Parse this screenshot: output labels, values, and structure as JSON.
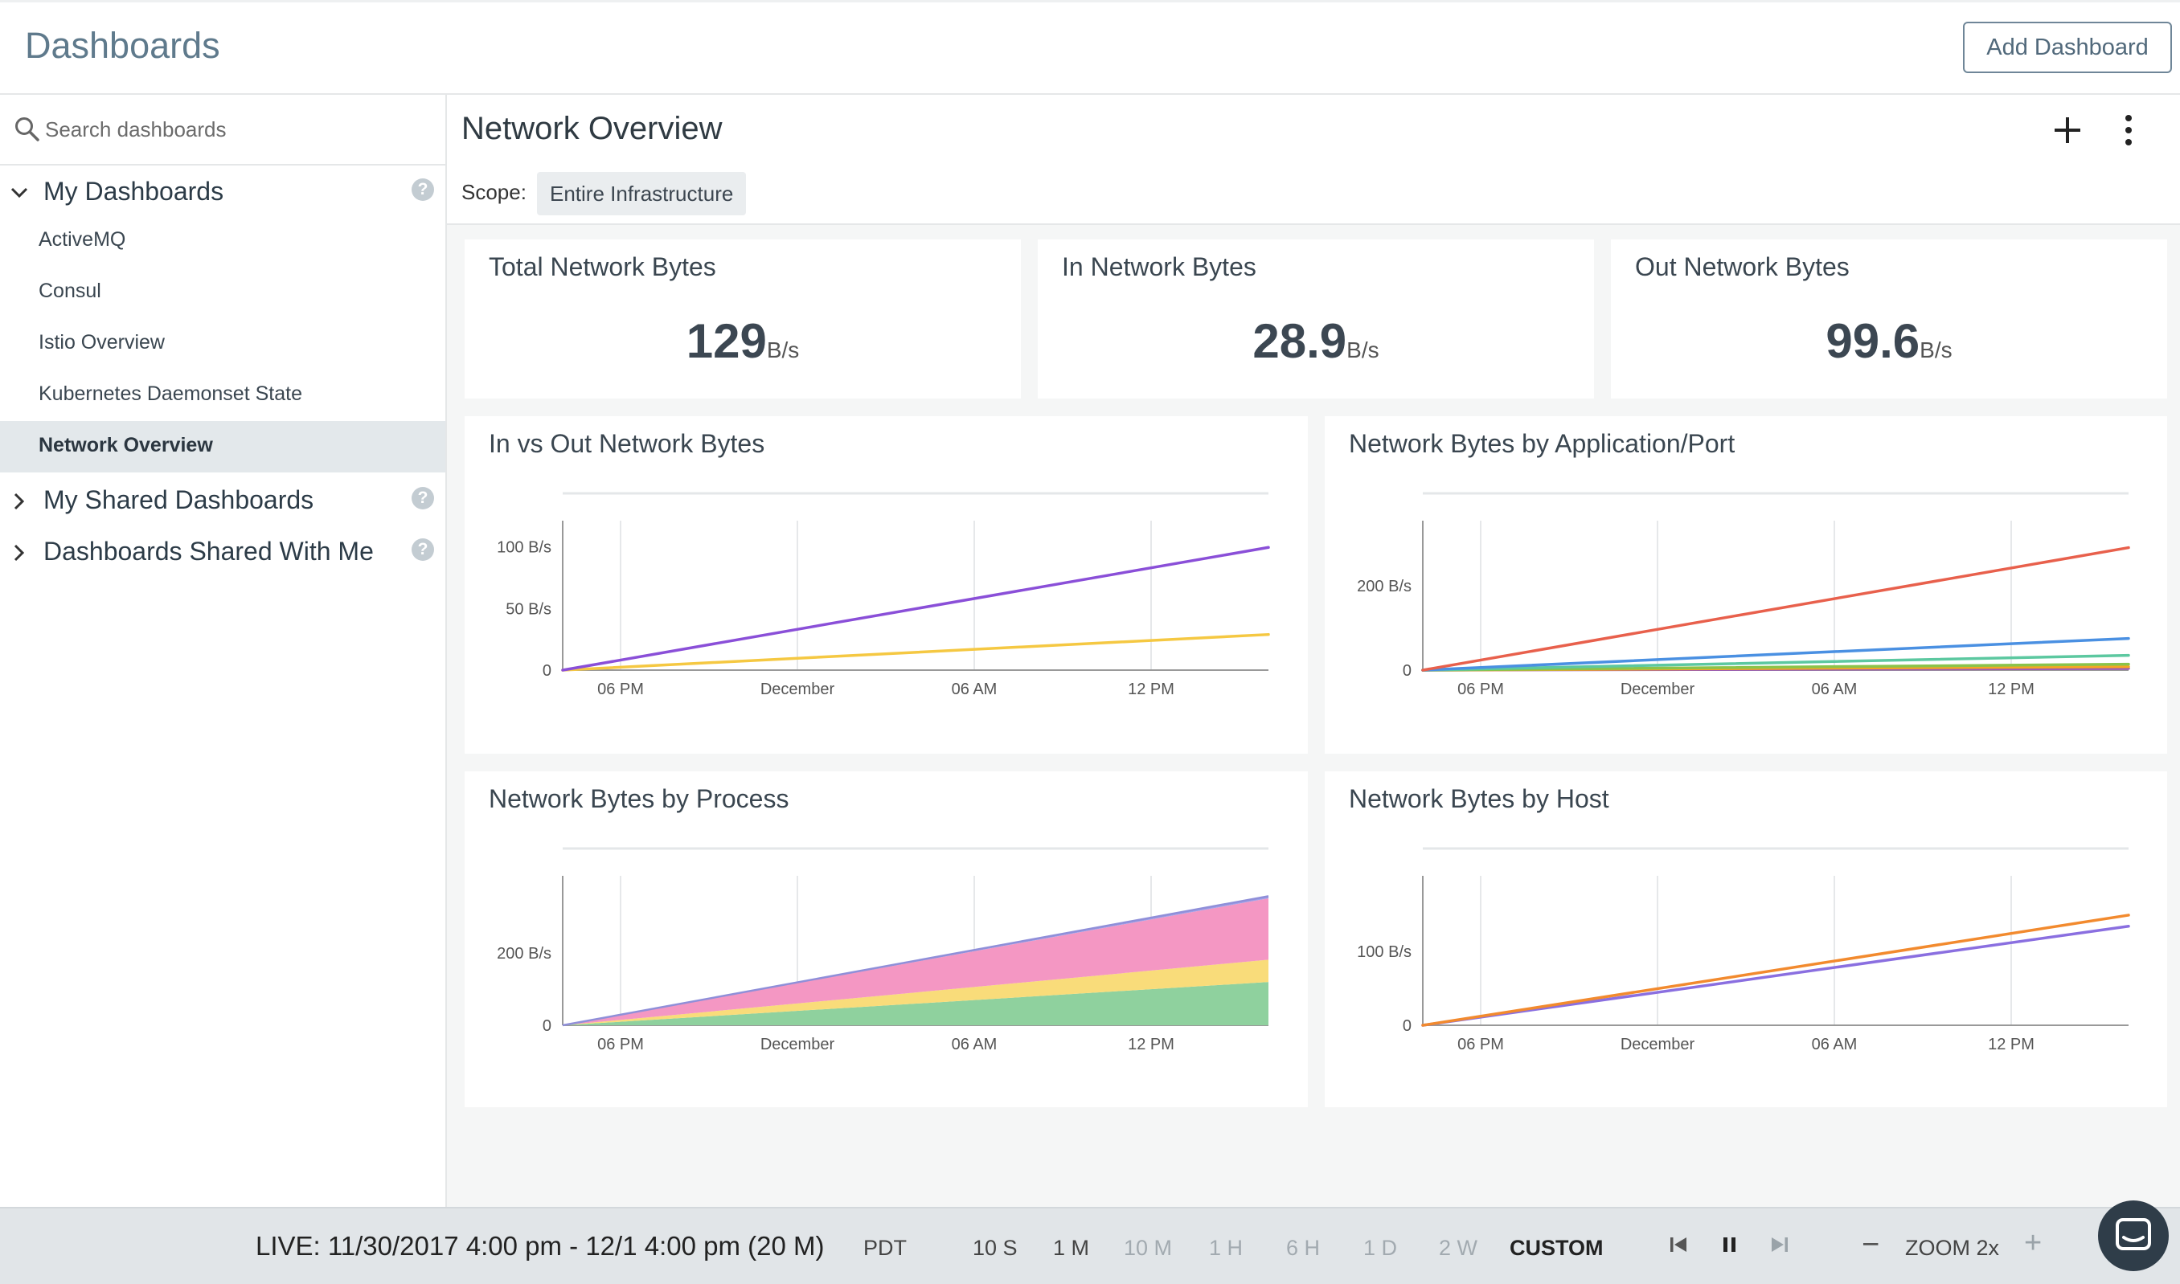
{
  "header": {
    "title": "Dashboards",
    "add_button": "Add Dashboard"
  },
  "sidebar": {
    "search_placeholder": "Search dashboards",
    "groups": [
      {
        "label": "My Dashboards",
        "expanded": true
      },
      {
        "label": "My Shared Dashboards",
        "expanded": false
      },
      {
        "label": "Dashboards Shared With Me",
        "expanded": false
      }
    ],
    "items": [
      {
        "label": "ActiveMQ"
      },
      {
        "label": "Consul"
      },
      {
        "label": "Istio Overview"
      },
      {
        "label": "Kubernetes Daemonset State"
      },
      {
        "label": "Network Overview",
        "active": true
      }
    ]
  },
  "main": {
    "title": "Network Overview",
    "scope_label": "Scope:",
    "scope_value": "Entire Infrastructure"
  },
  "stats": [
    {
      "title": "Total Network Bytes",
      "value": "129",
      "unit": "B/s"
    },
    {
      "title": "In Network Bytes",
      "value": "28.9",
      "unit": "B/s"
    },
    {
      "title": "Out Network Bytes",
      "value": "99.6",
      "unit": "B/s"
    }
  ],
  "chart_data": [
    {
      "type": "line",
      "title": "In vs Out Network Bytes",
      "x_ticks": [
        "06 PM",
        "December",
        "06 AM",
        "12 PM"
      ],
      "y_ticks": [
        "0",
        "50 B/s",
        "100 B/s"
      ],
      "ylim": [
        0,
        120
      ],
      "x": [
        0,
        1
      ],
      "series": [
        {
          "color": "#8a4fd8",
          "values": [
            0,
            99.6
          ]
        },
        {
          "color": "#f5c842",
          "values": [
            0,
            28.9
          ]
        }
      ]
    },
    {
      "type": "line",
      "title": "Network Bytes by Application/Port",
      "x_ticks": [
        "06 PM",
        "December",
        "06 AM",
        "12 PM"
      ],
      "y_ticks": [
        "0",
        "200 B/s"
      ],
      "ylim": [
        0,
        350
      ],
      "x": [
        0,
        1
      ],
      "series": [
        {
          "color": "#e8604c",
          "values": [
            0,
            290
          ]
        },
        {
          "color": "#4a90e2",
          "values": [
            0,
            75
          ]
        },
        {
          "color": "#5cc8a0",
          "values": [
            0,
            35
          ]
        },
        {
          "color": "#8bc34a",
          "values": [
            0,
            14
          ]
        },
        {
          "color": "#f5a623",
          "values": [
            0,
            8
          ]
        },
        {
          "color": "#9b59b6",
          "values": [
            0,
            4
          ]
        }
      ]
    },
    {
      "type": "area",
      "title": "Network Bytes by Process",
      "x_ticks": [
        "06 PM",
        "December",
        "06 AM",
        "12 PM"
      ],
      "y_ticks": [
        "0",
        "200 B/s"
      ],
      "ylim": [
        0,
        410
      ],
      "x": [
        0,
        1
      ],
      "stacked": true,
      "series": [
        {
          "color": "#8fd19e",
          "values": [
            0,
            120
          ]
        },
        {
          "color": "#f9dc7a",
          "values": [
            0,
            62
          ]
        },
        {
          "color": "#f497c3",
          "values": [
            0,
            170
          ]
        },
        {
          "color": "#a0a0e8",
          "values": [
            0,
            6
          ]
        }
      ]
    },
    {
      "type": "line",
      "title": "Network Bytes by Host",
      "x_ticks": [
        "06 PM",
        "December",
        "06 AM",
        "12 PM"
      ],
      "y_ticks": [
        "0",
        "100 B/s"
      ],
      "ylim": [
        0,
        200
      ],
      "x": [
        0,
        1
      ],
      "series": [
        {
          "color": "#f28a2e",
          "values": [
            0,
            149
          ]
        },
        {
          "color": "#8a6fe0",
          "values": [
            0,
            134
          ]
        }
      ]
    }
  ],
  "timebar": {
    "live": "LIVE: 11/30/2017 4:00 pm - 12/1 4:00 pm (20 M)",
    "timezone": "PDT",
    "ranges": [
      {
        "label": "10 S",
        "state": "on"
      },
      {
        "label": "1 M",
        "state": "on"
      },
      {
        "label": "10 M",
        "state": "off"
      },
      {
        "label": "1 H",
        "state": "off"
      },
      {
        "label": "6 H",
        "state": "off"
      },
      {
        "label": "1 D",
        "state": "off"
      },
      {
        "label": "2 W",
        "state": "off"
      },
      {
        "label": "CUSTOM",
        "state": "custom"
      }
    ],
    "zoom": "ZOOM 2x"
  }
}
